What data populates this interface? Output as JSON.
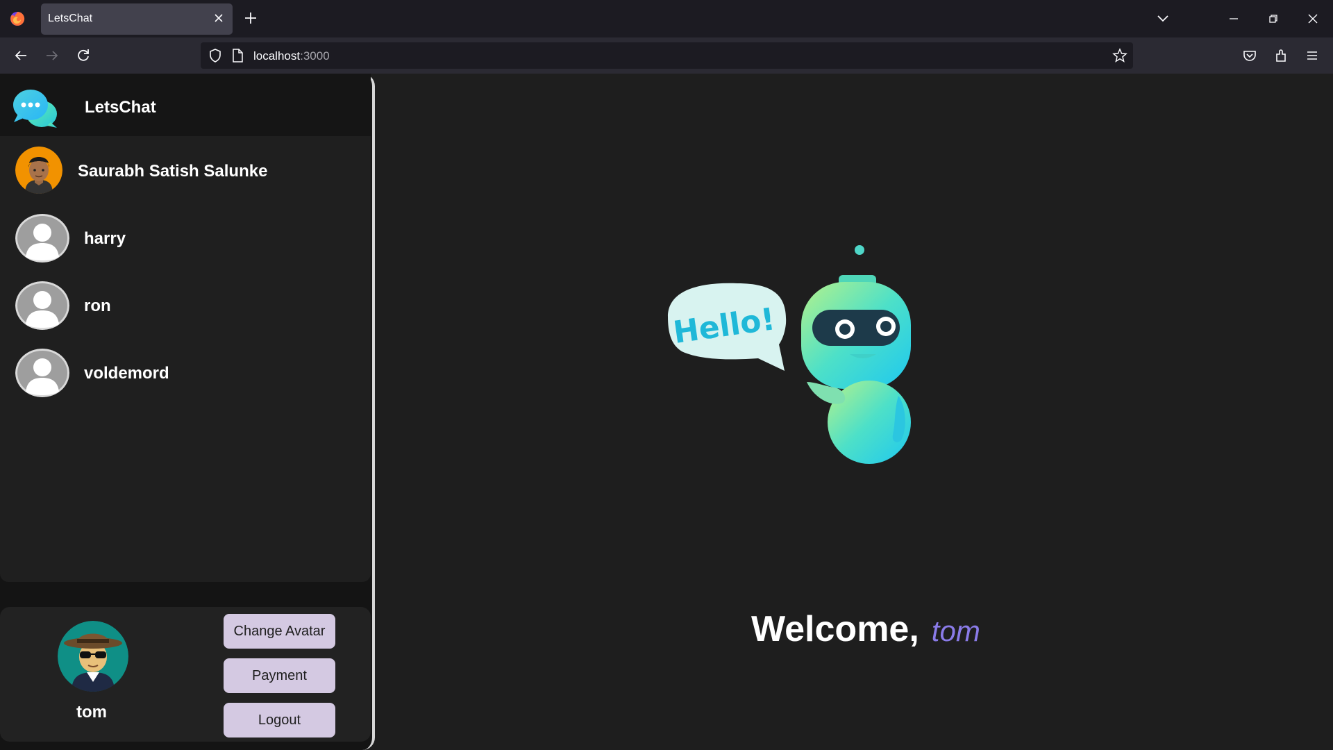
{
  "browser": {
    "tab_title": "LetsChat",
    "url_host": "localhost",
    "url_port": ":3000"
  },
  "app": {
    "brand_name": "LetsChat",
    "contacts": [
      {
        "name": "Saurabh Satish Salunke",
        "avatar": "cartoon-avatar"
      },
      {
        "name": "harry",
        "avatar": "default-user-avatar"
      },
      {
        "name": "ron",
        "avatar": "default-user-avatar"
      },
      {
        "name": "voldemord",
        "avatar": "default-user-avatar"
      }
    ],
    "current_user": {
      "name": "tom",
      "avatar": "hat-sunglasses-avatar"
    },
    "buttons": {
      "change_avatar": "Change Avatar",
      "payment": "Payment",
      "logout": "Logout"
    },
    "welcome": {
      "text": "Welcome,",
      "user": "tom",
      "illustration_text": "Hello!"
    }
  },
  "colors": {
    "accent": "#8a7be8",
    "button_bg": "#d4c9e2",
    "sidebar_bg": "#1f1f1f",
    "main_bg": "#1e1e1e"
  }
}
